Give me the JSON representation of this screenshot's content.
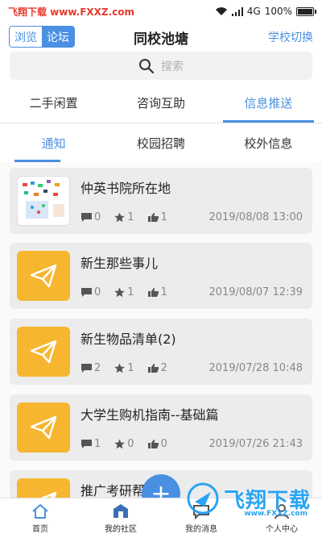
{
  "statusbar": {
    "watermark": "飞翔下载 www.FXXZ.com",
    "network": "4G",
    "battery": "100%"
  },
  "header": {
    "seg_browse": "浏览",
    "seg_forum": "论坛",
    "title": "同校池塘",
    "switch_school": "学校切换"
  },
  "search": {
    "placeholder": "搜索"
  },
  "main_tabs": [
    "二手闲置",
    "咨询互助",
    "信息推送"
  ],
  "sub_tabs": [
    "通知",
    "校园招聘",
    "校外信息"
  ],
  "posts": [
    {
      "title": "仲英书院所在地",
      "comments": "0",
      "stars": "1",
      "likes": "1",
      "date": "2019/08/08 13:00",
      "thumb": "photo"
    },
    {
      "title": "新生那些事儿",
      "comments": "0",
      "stars": "1",
      "likes": "1",
      "date": "2019/08/07 12:39",
      "thumb": "paper-plane-icon"
    },
    {
      "title": "新生物品清单(2)",
      "comments": "2",
      "stars": "1",
      "likes": "2",
      "date": "2019/07/28 10:48",
      "thumb": "paper-plane-icon"
    },
    {
      "title": "大学生购机指南--基础篇",
      "comments": "1",
      "stars": "0",
      "likes": "0",
      "date": "2019/07/26 21:43",
      "thumb": "paper-plane-icon"
    },
    {
      "title": "推广考研帮",
      "thumb": "paper-plane-icon"
    }
  ],
  "bottom_nav": [
    "首页",
    "我的社区",
    "我的消息",
    "个人中心"
  ],
  "bottom_watermark": {
    "text": "飞翔下载",
    "url": "www.FXXZ.com"
  },
  "colors": {
    "accent": "#4a90e2",
    "thumb_orange": "#f6b630",
    "watermark_red": "#e83a2b"
  }
}
